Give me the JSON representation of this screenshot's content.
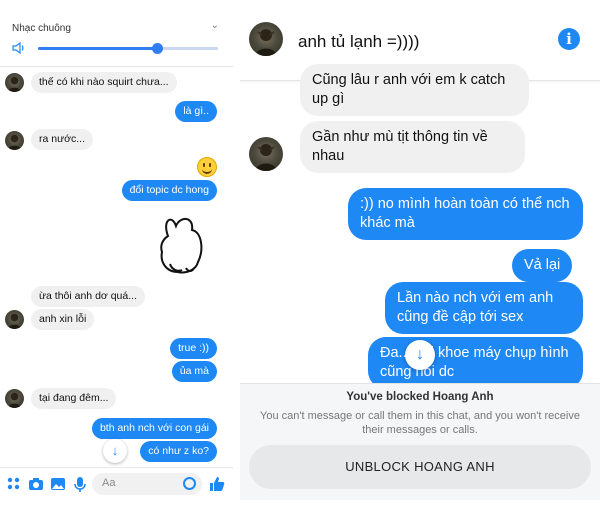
{
  "left": {
    "volume": {
      "title": "Nhạc chuông",
      "level_percent": 66
    },
    "messages": [
      {
        "dir": "in",
        "text": "thế có khi nào squirt chưa..."
      },
      {
        "dir": "out",
        "text": "là gì.."
      },
      {
        "dir": "in",
        "text": "ra nước..."
      },
      {
        "dir": "out",
        "text": "đổi topic dc hong"
      },
      {
        "dir": "in",
        "text": "ừa thôi anh dơ quá..."
      },
      {
        "dir": "in",
        "text": "anh xin lỗi"
      },
      {
        "dir": "out",
        "text": "true :))"
      },
      {
        "dir": "out",
        "text": "ủa mà"
      },
      {
        "dir": "in",
        "text": "tại đang đêm..."
      },
      {
        "dir": "out",
        "text": "bth anh nch với con gái"
      },
      {
        "dir": "out",
        "text": "có như z ko?"
      }
    ],
    "composer": {
      "placeholder": "Aa"
    },
    "icons": [
      "grid-icon",
      "camera-icon",
      "image-icon",
      "microphone-icon",
      "emoji-icon",
      "like-icon"
    ]
  },
  "right": {
    "contact_name": "anh tủ lạnh =))))",
    "messages": [
      {
        "dir": "in",
        "text": "Cũng lâu r anh với em k catch up gì"
      },
      {
        "dir": "in",
        "text": "Gần như mù tịt thông tin về nhau"
      },
      {
        "dir": "out",
        "text": ":)) no mình hoàn toàn có thể nch khác mà"
      },
      {
        "dir": "out",
        "text": "Vả lại"
      },
      {
        "dir": "out",
        "text": "Lần nào nch với em anh cũng đề cập tới sex"
      },
      {
        "dir": "out",
        "text": "Đa... hồi khoe máy chụp hình cũng nói dc"
      }
    ],
    "blocked": {
      "title": "You've blocked Hoang Anh",
      "subtitle": "You can't message or call them in this chat, and you won't receive their messages or calls.",
      "button_label": "UNBLOCK HOANG ANH"
    }
  },
  "colors": {
    "accent": "#1e88f5",
    "incoming_bubble": "#f1f0f0"
  }
}
